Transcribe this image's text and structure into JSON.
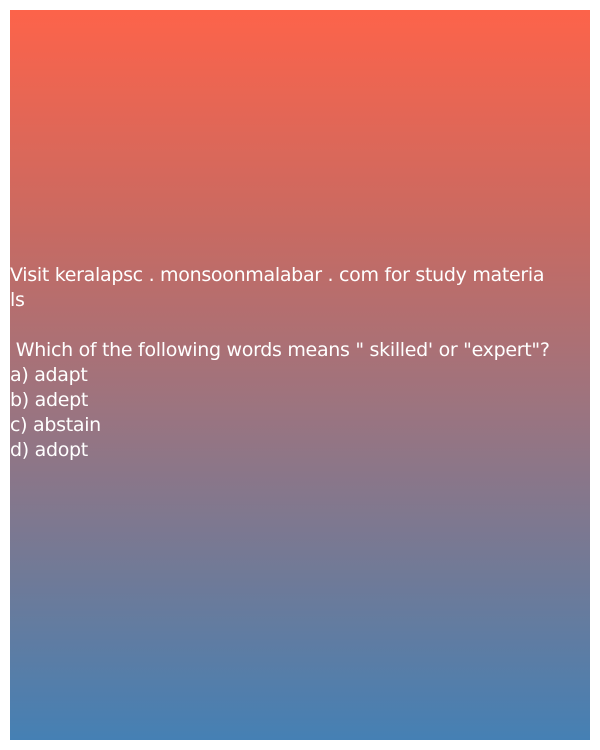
{
  "header": {
    "visit_line_1": "Visit keralapsc . monsoonmalabar . com for study materia",
    "visit_line_2": "ls"
  },
  "question": {
    "text": " Which of the following words means \" skilled' or \"expert\"?",
    "options": [
      "a) adapt",
      "b) adept",
      "c) abstain",
      "d) adopt"
    ]
  },
  "colors": {
    "gradient_top": "#fd634a",
    "gradient_bottom": "#4580b4",
    "text": "#ffffff"
  }
}
